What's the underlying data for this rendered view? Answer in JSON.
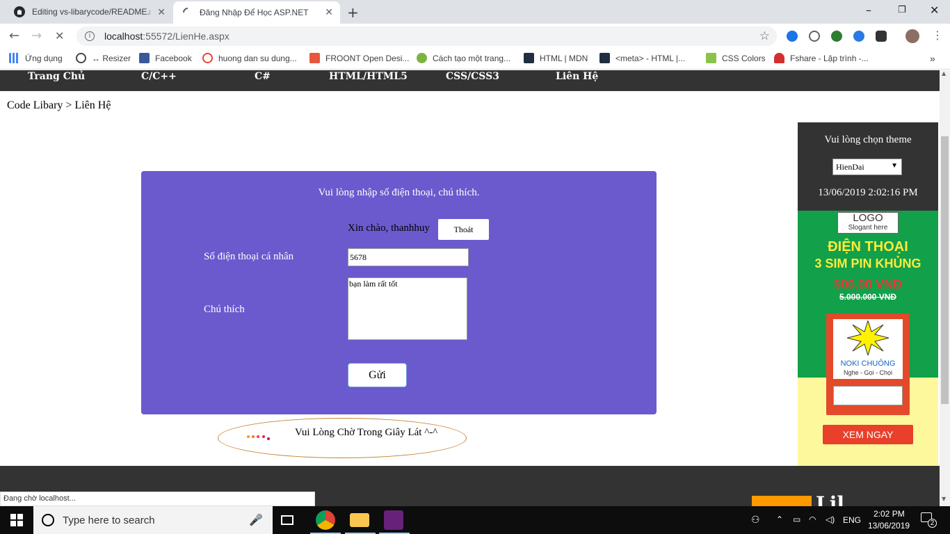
{
  "browser": {
    "tabs": [
      {
        "title": "Editing vs-libarycode/README.m",
        "icon": "github-icon"
      },
      {
        "title": "Đăng Nhập Để Học ASP.NET",
        "icon": "loading-spinner-icon"
      }
    ],
    "url_host": "localhost",
    "url_path": ":55572/LienHe.aspx",
    "bookmarks": [
      "Ứng dụng",
      "↔ Resizer",
      "Facebook",
      "huong dan su dung...",
      "FROONT Open Desi...",
      "Cách tạo một trang...",
      "HTML | MDN",
      "<meta> - HTML |...",
      "CSS Colors",
      "Fshare - Lập trình -..."
    ],
    "status_text": "Đang chờ localhost..."
  },
  "page": {
    "nav": [
      "Trang Chủ",
      "C/C++",
      "C#",
      "HTML/HTML5",
      "CSS/CSS3",
      "Liên Hệ"
    ],
    "breadcrumb": "Code Libary > Liên Hệ",
    "form": {
      "instruction": "Vui lòng nhập số điện thoại, chú thích.",
      "greeting": "Xin chào, thanhhuy",
      "logout_label": "Thoát",
      "phone_label": "Số điện thoại cá nhân",
      "phone_value": "5678",
      "note_label": "Chú thích",
      "note_value": "bạn làm rất tốt",
      "send_label": "Gửi"
    },
    "loading_text": "Vui Lòng Chờ Trong Giây Lát ^-^",
    "sidebar": {
      "theme_label": "Vui lòng chọn theme",
      "theme_selected": "HienDai",
      "datetime": "13/06/2019 2:02:16 PM",
      "ad": {
        "logo_line1": "LOGO",
        "logo_line2": "Slogant here",
        "headline1": "ĐIỆN THOẠI",
        "headline2": "3 SIM PIN KHỦNG",
        "price": "500.00 VNĐ",
        "old_price": "5.000.000 VNĐ",
        "brand": "NOKI CHUÔNG",
        "tagline": "Nghe - Gọi - Chọi",
        "cta": "XEM NGAY"
      }
    },
    "footer_text": "Lil"
  },
  "taskbar": {
    "search_placeholder": "Type here to search",
    "language": "ENG",
    "time": "2:02 PM",
    "date": "13/06/2019",
    "notification_count": "2"
  },
  "colors": {
    "nav_bg": "#333333",
    "form_bg": "#6a5acd",
    "ad_green": "#12a04a",
    "ad_red": "#e24a2a"
  }
}
